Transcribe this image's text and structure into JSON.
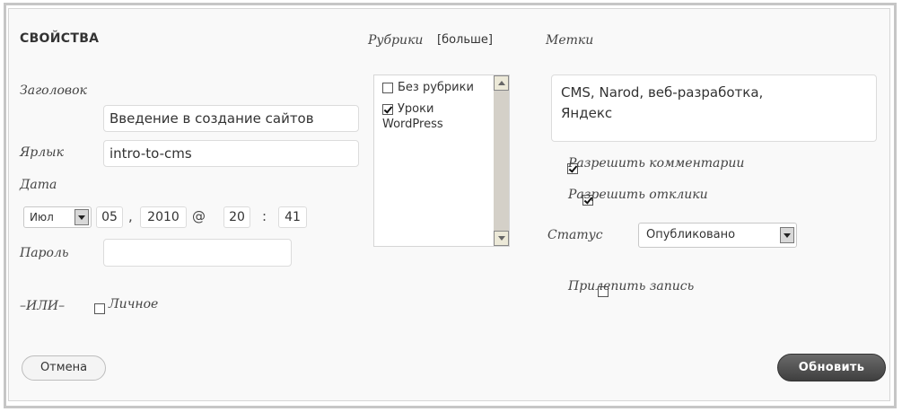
{
  "panel": {
    "title": "СВОЙСТВА",
    "cancel_label": "Отмена",
    "update_label": "Обновить"
  },
  "left": {
    "title_label": "Заголовок",
    "title_value": "Введение в создание сайтов",
    "slug_label": "Ярлык",
    "slug_value": "intro-to-cms",
    "date_label": "Дата",
    "month": "Июл",
    "day": "05",
    "year": "2010",
    "hour": "20",
    "minute": "41",
    "comma": ",",
    "at": "@",
    "colon": ":",
    "password_label": "Пароль",
    "password_value": "",
    "or_label": "–ИЛИ–",
    "private_label": "Личное"
  },
  "categories": {
    "heading": "Рубрики",
    "more_link": "[больше]",
    "items": [
      {
        "label": "Без рубрики",
        "checked": false
      },
      {
        "label": "Уроки",
        "label2": "WordPress",
        "checked": true
      }
    ]
  },
  "right": {
    "tags_label": "Метки",
    "tags_value_line1": "CMS, Narod, веб-разработка,",
    "tags_value_line2": "Яндекс",
    "allow_comments_label": "Разрешить комментарии",
    "allow_comments_checked": true,
    "allow_pings_label": "Разрешить отклики",
    "allow_pings_checked": true,
    "status_label": "Статус",
    "status_value": "Опубликовано",
    "sticky_label": "Прилепить запись",
    "sticky_checked": false
  }
}
